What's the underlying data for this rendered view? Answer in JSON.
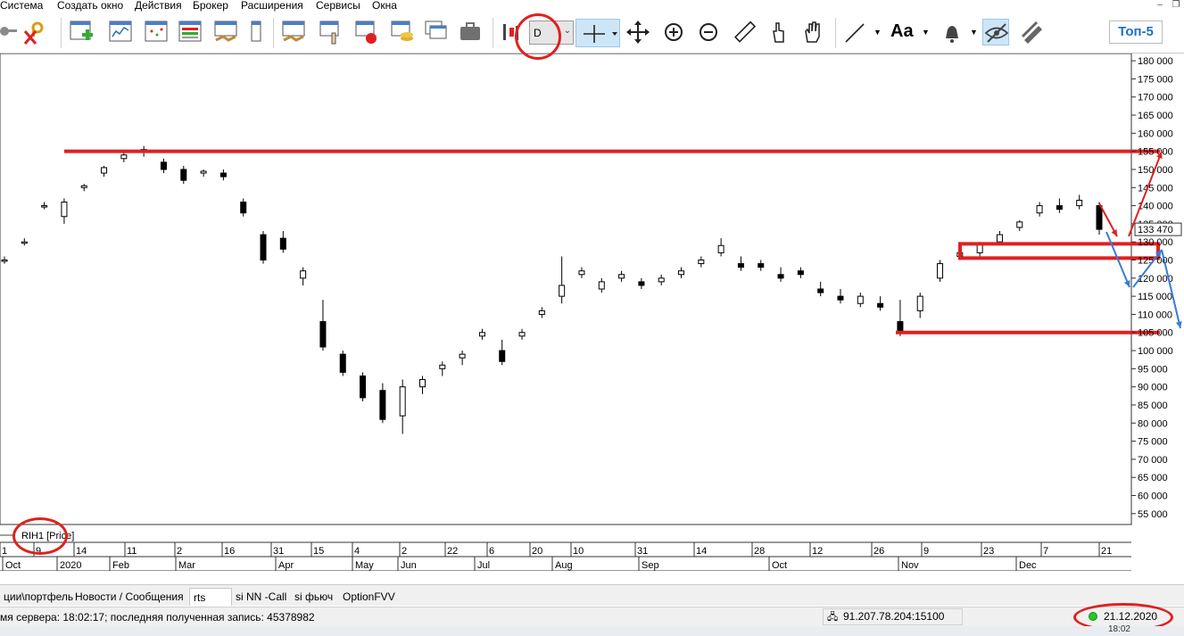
{
  "menu": [
    "Система",
    "Создать окно",
    "Действия",
    "Брокер",
    "Расширения",
    "Сервисы",
    "Окна"
  ],
  "toolbar": {
    "period_value": "D",
    "top5_label": "Топ-5",
    "text_tool_label": "Aa"
  },
  "chart": {
    "instrument_label": "RIH1 [Price]",
    "price_tag": "133 470",
    "y_ticks": [
      "180 000",
      "175 000",
      "170 000",
      "165 000",
      "160 000",
      "155 000",
      "150 000",
      "145 000",
      "140 000",
      "135 000",
      "130 000",
      "125 000",
      "120 000",
      "115 000",
      "110 000",
      "105 000",
      "100 000",
      "95 000",
      "90 000",
      "85 000",
      "80 000",
      "75 000",
      "70 000",
      "65 000",
      "60 000",
      "55 000"
    ],
    "x_top_labels": [
      "1",
      "9",
      "14",
      "11",
      "2",
      "16",
      "31",
      "15",
      "4",
      "2",
      "22",
      "6",
      "20",
      "10",
      "31",
      "14",
      "28",
      "12",
      "26",
      "9",
      "23",
      "7",
      "21"
    ],
    "x_bottom_labels": [
      "Oct",
      "2020",
      "Feb",
      "Mar",
      "Apr",
      "May",
      "Jun",
      "Jul",
      "Aug",
      "Sep",
      "Oct",
      "Nov",
      "Dec"
    ]
  },
  "chart_data": {
    "type": "candlestick",
    "ylim": [
      52000,
      182000
    ],
    "price_tag_value": 133470,
    "support_resistance_levels": [
      155000,
      127500,
      105000
    ],
    "period": "D",
    "ohlc_sampled": [
      {
        "o": 125000,
        "h": 126000,
        "l": 124000,
        "c": 125000
      },
      {
        "o": 130000,
        "h": 131000,
        "l": 129000,
        "c": 130000
      },
      {
        "o": 140000,
        "h": 141000,
        "l": 139000,
        "c": 140000
      },
      {
        "o": 137000,
        "h": 142000,
        "l": 135000,
        "c": 141000
      },
      {
        "o": 145000,
        "h": 146000,
        "l": 144000,
        "c": 145500
      },
      {
        "o": 149000,
        "h": 151000,
        "l": 148000,
        "c": 150500
      },
      {
        "o": 153000,
        "h": 155000,
        "l": 152000,
        "c": 154000
      },
      {
        "o": 155000,
        "h": 156500,
        "l": 153500,
        "c": 155500
      },
      {
        "o": 152000,
        "h": 153000,
        "l": 149000,
        "c": 150000
      },
      {
        "o": 150000,
        "h": 151000,
        "l": 146000,
        "c": 147000
      },
      {
        "o": 149000,
        "h": 150000,
        "l": 148000,
        "c": 149500
      },
      {
        "o": 149000,
        "h": 150000,
        "l": 147000,
        "c": 148000
      },
      {
        "o": 141000,
        "h": 142000,
        "l": 137000,
        "c": 138000
      },
      {
        "o": 132000,
        "h": 133000,
        "l": 124000,
        "c": 125000
      },
      {
        "o": 131000,
        "h": 133000,
        "l": 127000,
        "c": 128000
      },
      {
        "o": 120000,
        "h": 123000,
        "l": 118000,
        "c": 122000
      },
      {
        "o": 108000,
        "h": 114000,
        "l": 100000,
        "c": 101000
      },
      {
        "o": 99000,
        "h": 100000,
        "l": 93000,
        "c": 94000
      },
      {
        "o": 93000,
        "h": 94000,
        "l": 86000,
        "c": 87000
      },
      {
        "o": 89000,
        "h": 91000,
        "l": 80000,
        "c": 81000
      },
      {
        "o": 82000,
        "h": 92000,
        "l": 77000,
        "c": 90000
      },
      {
        "o": 90000,
        "h": 93000,
        "l": 88000,
        "c": 92000
      },
      {
        "o": 95000,
        "h": 97000,
        "l": 93000,
        "c": 96000
      },
      {
        "o": 98000,
        "h": 100000,
        "l": 96000,
        "c": 99000
      },
      {
        "o": 104000,
        "h": 106000,
        "l": 103000,
        "c": 105000
      },
      {
        "o": 100000,
        "h": 103000,
        "l": 96000,
        "c": 97000
      },
      {
        "o": 104000,
        "h": 106000,
        "l": 103000,
        "c": 105000
      },
      {
        "o": 110000,
        "h": 112000,
        "l": 109000,
        "c": 111000
      },
      {
        "o": 115000,
        "h": 126000,
        "l": 113000,
        "c": 118000
      },
      {
        "o": 121000,
        "h": 123000,
        "l": 120000,
        "c": 122000
      },
      {
        "o": 117000,
        "h": 120000,
        "l": 116000,
        "c": 119000
      },
      {
        "o": 120000,
        "h": 122000,
        "l": 119000,
        "c": 121000
      },
      {
        "o": 119000,
        "h": 120000,
        "l": 117000,
        "c": 118000
      },
      {
        "o": 119000,
        "h": 121000,
        "l": 118000,
        "c": 120000
      },
      {
        "o": 121000,
        "h": 123000,
        "l": 120000,
        "c": 122000
      },
      {
        "o": 124000,
        "h": 126000,
        "l": 123000,
        "c": 125000
      },
      {
        "o": 127000,
        "h": 131000,
        "l": 126000,
        "c": 129000
      },
      {
        "o": 124000,
        "h": 126000,
        "l": 122000,
        "c": 123000
      },
      {
        "o": 124000,
        "h": 125000,
        "l": 122000,
        "c": 123000
      },
      {
        "o": 121000,
        "h": 123000,
        "l": 119000,
        "c": 120000
      },
      {
        "o": 122000,
        "h": 123000,
        "l": 120000,
        "c": 121000
      },
      {
        "o": 117000,
        "h": 119000,
        "l": 115000,
        "c": 116000
      },
      {
        "o": 115000,
        "h": 117000,
        "l": 113000,
        "c": 114000
      },
      {
        "o": 113000,
        "h": 116000,
        "l": 112000,
        "c": 115000
      },
      {
        "o": 113000,
        "h": 115000,
        "l": 111000,
        "c": 112000
      },
      {
        "o": 108000,
        "h": 114000,
        "l": 104000,
        "c": 105000
      },
      {
        "o": 111000,
        "h": 116000,
        "l": 109000,
        "c": 115000
      },
      {
        "o": 120000,
        "h": 125000,
        "l": 119000,
        "c": 124000
      },
      {
        "o": 126000,
        "h": 128000,
        "l": 125000,
        "c": 127000
      },
      {
        "o": 127000,
        "h": 130000,
        "l": 126000,
        "c": 129500
      },
      {
        "o": 130000,
        "h": 133000,
        "l": 129000,
        "c": 132000
      },
      {
        "o": 134000,
        "h": 136000,
        "l": 133000,
        "c": 135500
      },
      {
        "o": 138000,
        "h": 141000,
        "l": 137000,
        "c": 140000
      },
      {
        "o": 140000,
        "h": 142000,
        "l": 138000,
        "c": 139000
      },
      {
        "o": 140000,
        "h": 143000,
        "l": 139000,
        "c": 141500
      },
      {
        "o": 140000,
        "h": 141000,
        "l": 132000,
        "c": 133470
      }
    ]
  },
  "tabs": [
    "ции\\портфель",
    "Новости / Сообщения",
    "rts",
    "si NN -Call",
    "si фьюч",
    "OptionFVV"
  ],
  "status": {
    "text": "мя сервера: 18:02:17; последняя полученная запись: 45378982",
    "server_address": "91.207.78.204:15100",
    "date": "21.12.2020"
  },
  "taskbar": {
    "clock": "18:02"
  },
  "colors": {
    "accent_red": "#e02020",
    "arrow_blue": "#3a7bd5",
    "selected_tool_bg": "#cde6f7",
    "top5_blue": "#1f6fc1"
  }
}
